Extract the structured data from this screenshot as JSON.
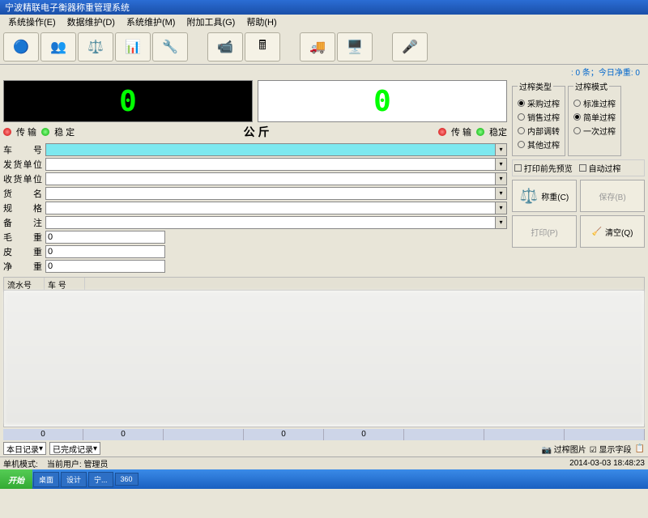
{
  "title": "宁波精联电子衡器称重管理系统",
  "menu": [
    "系统操作(E)",
    "数据维护(D)",
    "系统维护(M)",
    "附加工具(G)",
    "",
    "帮助(H)"
  ],
  "statusTop": ": 0 条；今日净重: 0",
  "display1": "0",
  "display2": "0",
  "statusRow": {
    "l1": "传 输",
    "l2": "稳 定",
    "unit": "公 斤",
    "r1": "传 输",
    "r2": "稳定"
  },
  "labels": {
    "carNo": "车 号",
    "shipper": "发货单位",
    "receiver": "收货单位",
    "goods": "货 名",
    "spec": "规 格",
    "remark": "备 注",
    "gross": "毛 重",
    "tare": "皮 重",
    "net": "净 重"
  },
  "values": {
    "gross": "0",
    "tare": "0",
    "net": "0"
  },
  "weighType": {
    "legend": "过榨类型",
    "opts": [
      "采购过榨",
      "销售过榨",
      "内部调转",
      "其他过榨"
    ],
    "sel": 0
  },
  "weighMode": {
    "legend": "过榨模式",
    "opts": [
      "标准过榨",
      "简单过榨",
      "一次过榨"
    ],
    "sel": 1
  },
  "checks": {
    "preview": "打印前先预览",
    "auto": "自动过榨"
  },
  "actions": {
    "weigh": "称重(C)",
    "save": "保存(B)",
    "print": "打印(P)",
    "clear": "清空(Q)"
  },
  "tblHead": [
    "流水号",
    "车 号"
  ],
  "summary": [
    "0",
    "0",
    "",
    "0",
    "0",
    "",
    "",
    ""
  ],
  "filters": {
    "f1": "本日记录",
    "f2": "已完成记录",
    "f3": "过榨图片",
    "f4": "显示字段",
    "f5": ""
  },
  "statusBar": {
    "mode": "单机模式:",
    "userLbl": "当前用户:",
    "user": "管理员",
    "date": "2014-03-03 18:48:23"
  },
  "taskbar": {
    "start": "开始",
    "items": [
      "桌面",
      "",
      "设计",
      "宁...",
      "",
      "360",
      ""
    ]
  }
}
